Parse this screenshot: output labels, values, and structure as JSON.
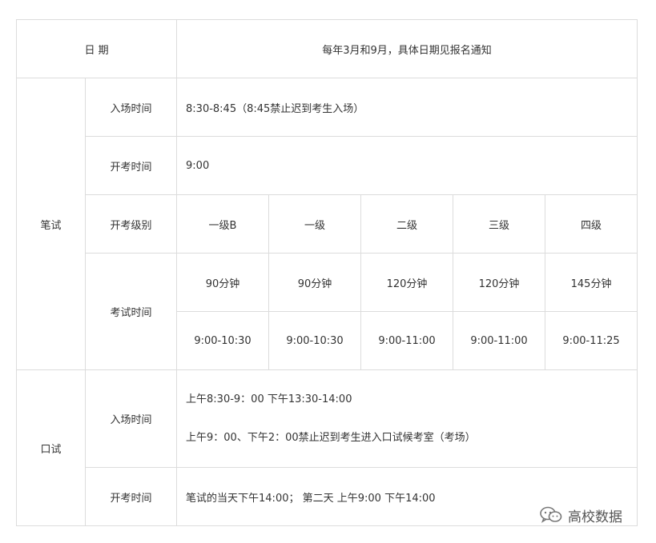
{
  "table": {
    "date_label": "日 期",
    "date_value": "每年3月和9月，具体日期见报名通知",
    "written": {
      "label": "笔试",
      "entry_label": "入场时间",
      "entry_value": "8:30-8:45（8:45禁止迟到考生入场）",
      "start_label": "开考时间",
      "start_value": "9:00",
      "level_label": "开考级别",
      "levels": [
        "一级B",
        "一级",
        "二级",
        "三级",
        "四级"
      ],
      "duration_label": "考试时间",
      "durations": [
        "90分钟",
        "90分钟",
        "120分钟",
        "120分钟",
        "145分钟"
      ],
      "times": [
        "9:00-10:30",
        "9:00-10:30",
        "9:00-11:00",
        "9:00-11:00",
        "9:00-11:25"
      ]
    },
    "oral": {
      "label": "口试",
      "entry_label": "入场时间",
      "entry_line1": "上午8:30-9：00  下午13:30-14:00",
      "entry_line2": "上午9：00、下午2：00禁止迟到考生进入口试候考室（考场）",
      "start_label": "开考时间",
      "start_value": "笔试的当天下午14:00； 第二天 上午9:00  下午14:00"
    }
  },
  "watermark": {
    "icon": "wechat-icon",
    "text": "高校数据"
  }
}
